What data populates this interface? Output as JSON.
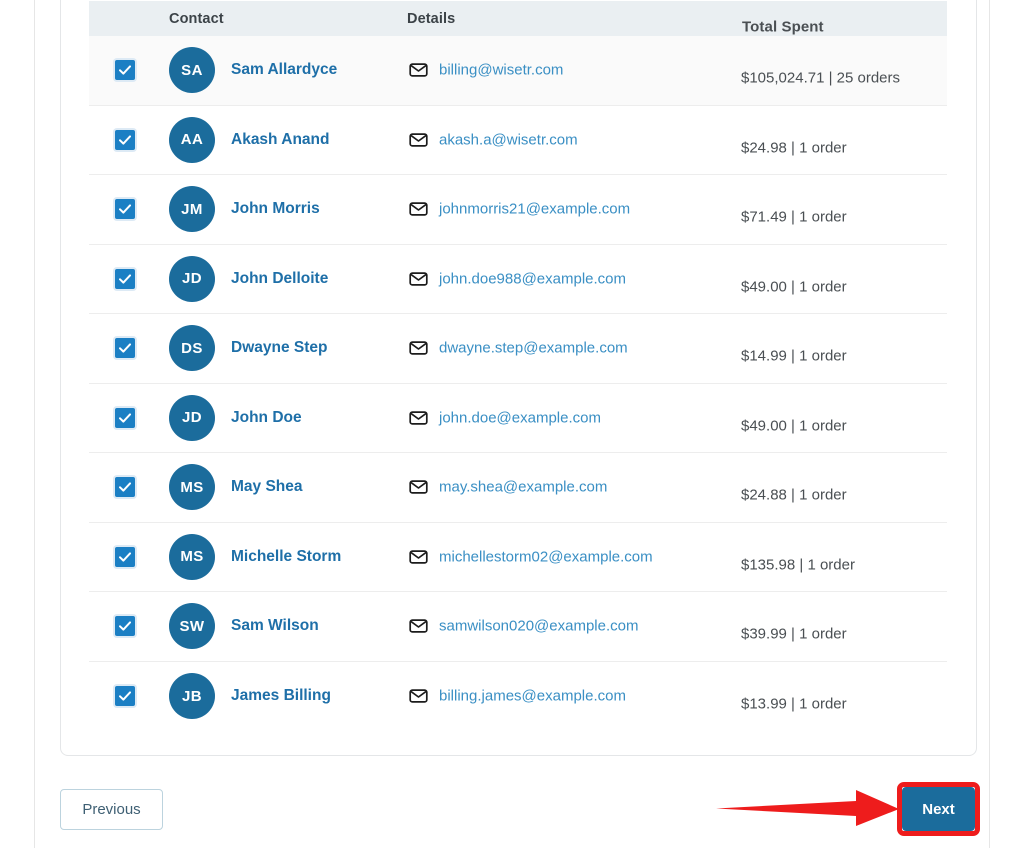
{
  "table": {
    "columns": {
      "select": "",
      "contact": "Contact",
      "details": "Details",
      "total_spent": "Total Spent"
    },
    "rows": [
      {
        "selected": true,
        "initials": "SA",
        "name": "Sam Allardyce",
        "email": "billing@wisetr.com",
        "total_spent": "$105,024.71 | 25 orders",
        "highlighted": true
      },
      {
        "selected": true,
        "initials": "AA",
        "name": "Akash Anand",
        "email": "akash.a@wisetr.com",
        "total_spent": "$24.98 | 1 order",
        "highlighted": false
      },
      {
        "selected": true,
        "initials": "JM",
        "name": "John Morris",
        "email": "johnmorris21@example.com",
        "total_spent": "$71.49 | 1 order",
        "highlighted": false
      },
      {
        "selected": true,
        "initials": "JD",
        "name": "John Delloite",
        "email": "john.doe988@example.com",
        "total_spent": "$49.00 | 1 order",
        "highlighted": false
      },
      {
        "selected": true,
        "initials": "DS",
        "name": "Dwayne Step",
        "email": "dwayne.step@example.com",
        "total_spent": "$14.99 | 1 order",
        "highlighted": false
      },
      {
        "selected": true,
        "initials": "JD",
        "name": "John Doe",
        "email": "john.doe@example.com",
        "total_spent": "$49.00 | 1 order",
        "highlighted": false
      },
      {
        "selected": true,
        "initials": "MS",
        "name": "May Shea",
        "email": "may.shea@example.com",
        "total_spent": "$24.88 | 1 order",
        "highlighted": false
      },
      {
        "selected": true,
        "initials": "MS",
        "name": "Michelle Storm",
        "email": "michellestorm02@example.com",
        "total_spent": "$135.98 | 1 order",
        "highlighted": false
      },
      {
        "selected": true,
        "initials": "SW",
        "name": "Sam Wilson",
        "email": "samwilson020@example.com",
        "total_spent": "$39.99 | 1 order",
        "highlighted": false
      },
      {
        "selected": true,
        "initials": "JB",
        "name": "James Billing",
        "email": "billing.james@example.com",
        "total_spent": "$13.99 | 1 order",
        "highlighted": false
      }
    ]
  },
  "pagination": {
    "previous_label": "Previous",
    "next_label": "Next"
  },
  "annotation": {
    "color": "#ee1c1c",
    "arrow": "arrow-right",
    "target": "Next"
  },
  "colors": {
    "avatar": "#1b6c9c",
    "checkbox": "#1b7fc4",
    "name_link": "#1e6fa8",
    "email_link": "#3a8fc4",
    "header_band": "#eaeff2",
    "primary_button": "#1b6c9c",
    "annotation_red": "#ee1c1c"
  }
}
